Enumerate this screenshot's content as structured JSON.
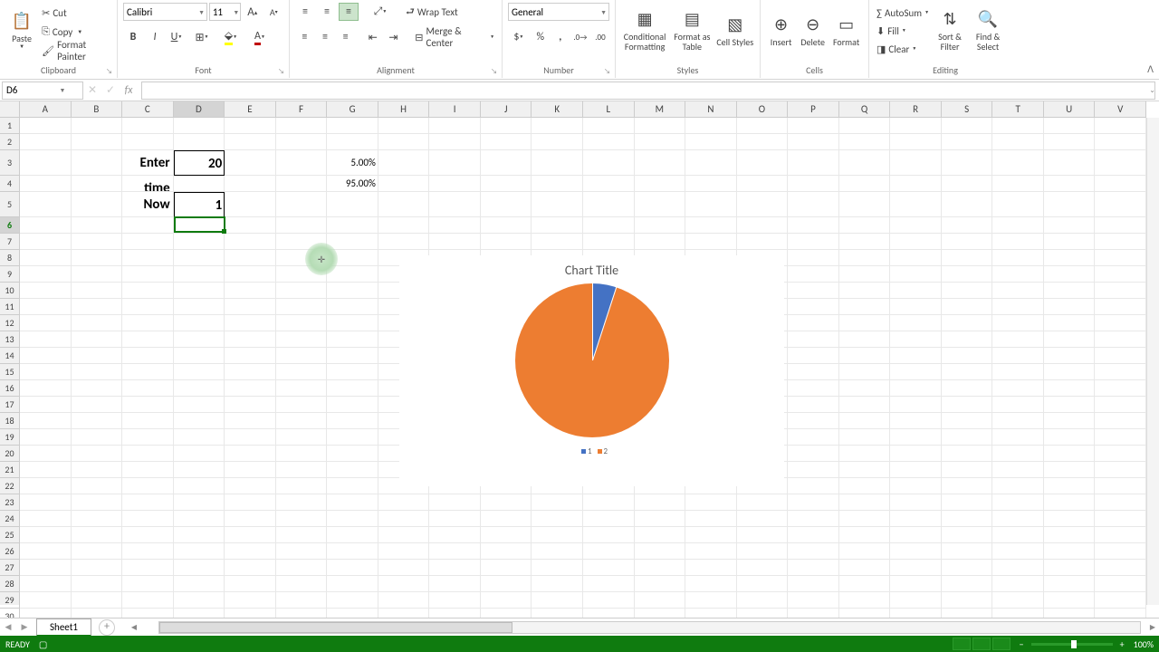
{
  "chart_data": {
    "type": "pie",
    "title": "Chart Title",
    "categories": [
      "1",
      "2"
    ],
    "values": [
      5.0,
      95.0
    ],
    "colors": [
      "#4472c4",
      "#ed7d31"
    ]
  },
  "ribbon": {
    "clipboard": {
      "label": "Clipboard",
      "paste": "Paste",
      "cut": "Cut",
      "copy": "Copy",
      "format_painter": "Format Painter"
    },
    "font": {
      "label": "Font",
      "name": "Calibri",
      "size": "11"
    },
    "alignment": {
      "label": "Alignment",
      "wrap": "Wrap Text",
      "merge": "Merge & Center"
    },
    "number": {
      "label": "Number",
      "format": "General"
    },
    "styles": {
      "label": "Styles",
      "cond": "Conditional Formatting",
      "table": "Format as Table",
      "cell": "Cell Styles"
    },
    "cells": {
      "label": "Cells",
      "insert": "Insert",
      "delete": "Delete",
      "format": "Format"
    },
    "editing": {
      "label": "Editing",
      "autosum": "AutoSum",
      "fill": "Fill",
      "clear": "Clear",
      "sort": "Sort & Filter",
      "find": "Find & Select"
    }
  },
  "namebox": "D6",
  "formula": "",
  "cols": [
    "A",
    "B",
    "C",
    "D",
    "E",
    "F",
    "G",
    "H",
    "I",
    "J",
    "K",
    "L",
    "M",
    "N",
    "O",
    "P",
    "Q",
    "R",
    "S",
    "T",
    "U",
    "V"
  ],
  "selected_col": "D",
  "selected_row": 6,
  "big_rows": [
    3,
    5
  ],
  "col_width_narrow": 57,
  "col_width_first": 57,
  "col_wide": 97,
  "cell_data": {
    "C3": "Enter time",
    "D3": "20",
    "C5": "Now",
    "D5": "1",
    "G3": "5.00%",
    "G4": "95.00%"
  },
  "chart": {
    "title": "Chart Title",
    "legend1": "1",
    "legend2": "2"
  },
  "sheet": "Sheet1",
  "status": "READY",
  "zoom": "100%"
}
